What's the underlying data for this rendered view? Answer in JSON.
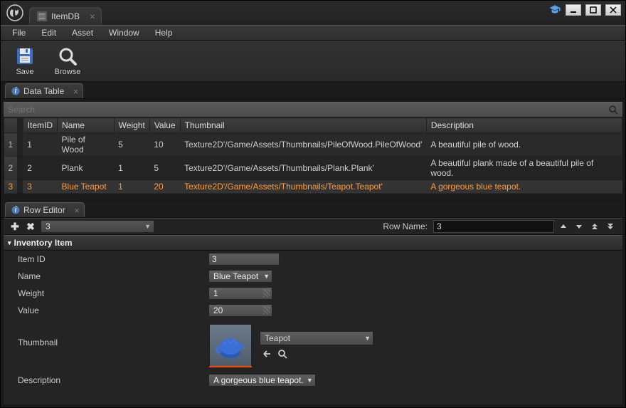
{
  "window": {
    "title": "ItemDB"
  },
  "menu": [
    "File",
    "Edit",
    "Asset",
    "Window",
    "Help"
  ],
  "toolbar": {
    "save": "Save",
    "browse": "Browse"
  },
  "panel_data_table": "Data Table",
  "panel_row_editor": "Row Editor",
  "search": {
    "placeholder": "Search"
  },
  "columns": [
    "",
    "ItemID",
    "Name",
    "Weight",
    "Value",
    "Thumbnail",
    "Description"
  ],
  "rows": [
    {
      "idx": "1",
      "ItemID": "1",
      "Name": "Pile of Wood",
      "Weight": "5",
      "Value": "10",
      "Thumbnail": "Texture2D'/Game/Assets/Thumbnails/PileOfWood.PileOfWood'",
      "Description": "A beautiful pile of wood."
    },
    {
      "idx": "2",
      "ItemID": "2",
      "Name": "Plank",
      "Weight": "1",
      "Value": "5",
      "Thumbnail": "Texture2D'/Game/Assets/Thumbnails/Plank.Plank'",
      "Description": "A beautiful plank made of a beautiful pile of wood."
    },
    {
      "idx": "3",
      "ItemID": "3",
      "Name": "Blue Teapot",
      "Weight": "1",
      "Value": "20",
      "Thumbnail": "Texture2D'/Game/Assets/Thumbnails/Teapot.Teapot'",
      "Description": "A gorgeous blue teapot."
    }
  ],
  "row_editor": {
    "add_tooltip": "+",
    "del_tooltip": "×",
    "selected_row": "3",
    "row_name_label": "Row Name:",
    "row_name_value": "3"
  },
  "section": "Inventory Item",
  "props": {
    "item_id": {
      "label": "Item ID",
      "value": "3"
    },
    "name": {
      "label": "Name",
      "value": "Blue Teapot"
    },
    "weight": {
      "label": "Weight",
      "value": "1"
    },
    "value": {
      "label": "Value",
      "value": "20"
    },
    "thumbnail": {
      "label": "Thumbnail",
      "asset": "Teapot"
    },
    "description": {
      "label": "Description",
      "value": "A gorgeous blue teapot."
    }
  }
}
